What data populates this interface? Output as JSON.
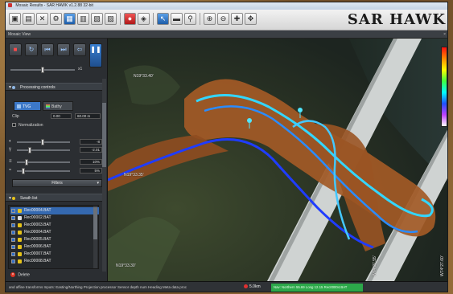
{
  "window": {
    "title": "Mosaic Results - SAR HAWK v1.2.88 32-bit",
    "brand": "SAR HAWK"
  },
  "panel": {
    "title": "Mosaic View",
    "close": "×"
  },
  "toolbar": {
    "icons": [
      "open-icon",
      "save-icon",
      "tools-icon",
      "settings-icon",
      "layers-icon",
      "display-icon",
      "export-icon",
      "record-icon",
      "navigate-icon",
      "pointer-icon",
      "measure-icon",
      "marker-icon",
      "zoom-in-icon",
      "zoom-out-icon",
      "fit-icon",
      "pan-icon"
    ]
  },
  "playback": {
    "speed": "x1"
  },
  "processing": {
    "title": "Processing controls",
    "tabs": [
      "TVG",
      "Bathy"
    ],
    "clip_label": "Clip",
    "clip_min": "0.00",
    "clip_max": "60.00 m",
    "normalization_label": "Normalization",
    "rows": [
      {
        "icon": "gain-icon",
        "value": "-8"
      },
      {
        "icon": "gamma-icon",
        "value": "-2.01"
      },
      {
        "icon": "contrast-icon",
        "value": "10%"
      },
      {
        "icon": "smooth-icon",
        "value": "5%"
      }
    ],
    "filters_label": "Filters"
  },
  "swath": {
    "title": "Swath list",
    "files": [
      {
        "name": "Rec00004.BAT",
        "color": "#e6c319",
        "selected": true
      },
      {
        "name": "Rec00002.BAT",
        "color": "#e0e0e0",
        "selected": false
      },
      {
        "name": "Rec00003.BAT",
        "color": "#e6c319",
        "selected": false
      },
      {
        "name": "Rec00004.BAT",
        "color": "#e6c319",
        "selected": false
      },
      {
        "name": "Rec00005.BAT",
        "color": "#e6c319",
        "selected": false
      },
      {
        "name": "Rec00006.BAT",
        "color": "#e6c319",
        "selected": false
      },
      {
        "name": "Rec00007.BAT",
        "color": "#e6c319",
        "selected": false
      },
      {
        "name": "Rec00008.BAT",
        "color": "#e6c319",
        "selected": false
      }
    ],
    "delete_label": "Delete"
  },
  "map": {
    "coords": {
      "lat_top": "N19°33.40'",
      "lat_mid": "N19°33.35'",
      "lat_bottom": "N19°33.30'",
      "lon_1": "W74°27.55'",
      "lon_2": "W74°27.60'"
    },
    "colors": {
      "track_dark": "#1f3cff",
      "track_light": "#33d6ff",
      "swath": "#a0582a",
      "bridge": "#cfd3d2",
      "water": "#1f2a22"
    }
  },
  "status": {
    "message": "and affine transforms Inputs: Easting/Northing Projection processor Sensor depth num Heading Meta data proc",
    "distance": "5.0km",
    "info": "Nav: Northern 55.69 Long 12.15 Rec00004.BAT"
  }
}
